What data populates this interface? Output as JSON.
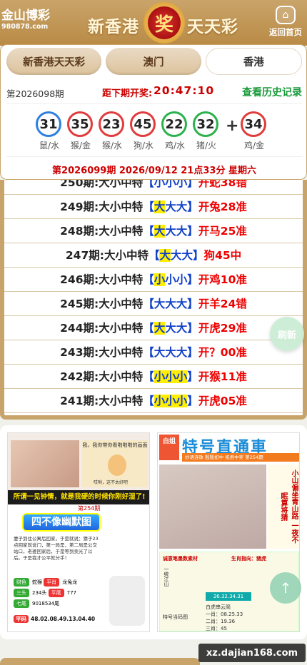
{
  "header": {
    "brand_name": "金山博彩",
    "brand_url": "980878.com",
    "title_left": "新香港",
    "title_right": "天天彩",
    "logo_char": "奖",
    "home_label": "返回首页"
  },
  "tabs": [
    {
      "label": "新香港天天彩",
      "active": false
    },
    {
      "label": "澳门",
      "active": false
    },
    {
      "label": "香港",
      "active": true
    }
  ],
  "result": {
    "period": "第2026098期",
    "next_label": "距下期开奖:",
    "countdown": "20:47:10",
    "history_link": "查看历史记录",
    "balls": [
      {
        "num": "31",
        "label": "鼠/水",
        "color": "#2d7fe0"
      },
      {
        "num": "35",
        "label": "猴/金",
        "color": "#e23b3b"
      },
      {
        "num": "23",
        "label": "猴/水",
        "color": "#e23b3b"
      },
      {
        "num": "45",
        "label": "狗/水",
        "color": "#e23b3b"
      },
      {
        "num": "22",
        "label": "鸡/水",
        "color": "#2bb24c"
      },
      {
        "num": "32",
        "label": "猪/火",
        "color": "#2bb24c"
      }
    ],
    "plus": "+",
    "special": {
      "num": "34",
      "label": "鸡/金",
      "color": "#e23b3b"
    },
    "next_draw": "第2026099期 2026/09/12 21点33分 星期六"
  },
  "history": [
    {
      "period": "250期:大小中特",
      "pick": [
        "小",
        "小",
        "小"
      ],
      "hl": -1,
      "result": "开蛇38错"
    },
    {
      "period": "249期:大小中特",
      "pick": [
        "大",
        "大",
        "大"
      ],
      "hl": 0,
      "result": "开兔28准"
    },
    {
      "period": "248期:大小中特",
      "pick": [
        "大",
        "大",
        "大"
      ],
      "hl": 0,
      "result": "开马25准"
    },
    {
      "period": "247期:大小中特",
      "pick": [
        "大",
        "大",
        "大"
      ],
      "hl": 0,
      "result": "狗45中"
    },
    {
      "period": "246期:大小中特",
      "pick": [
        "小",
        "小",
        "小"
      ],
      "hl": 0,
      "result": "开鸡10准"
    },
    {
      "period": "245期:大小中特",
      "pick": [
        "大",
        "大",
        "大"
      ],
      "hl": -1,
      "result": "开羊24错"
    },
    {
      "period": "244期:大小中特",
      "pick": [
        "大",
        "大",
        "大"
      ],
      "hl": 0,
      "result": "开虎29准"
    },
    {
      "period": "243期:大小中特",
      "pick": [
        "大",
        "大",
        "大"
      ],
      "hl": -1,
      "result": "开？00准"
    },
    {
      "period": "242期:大小中特",
      "pick": [
        "小",
        "小",
        "小"
      ],
      "hl": 9,
      "result": "开猴11准"
    },
    {
      "period": "241期:大小中特",
      "pick": [
        "小",
        "小",
        "小"
      ],
      "hl": 9,
      "result": "开虎05准"
    }
  ],
  "refresh_label": "刷新",
  "pic1": {
    "comic_caption": "我，我你带你看啪啪啪的画面",
    "comic_caption2": "哎哟，这不太好吧",
    "slogan": "所谓一见钟情，就是我硬的时候你刚好湿了!",
    "poster_title": "四不像幽默图",
    "poster_issue": "第254期",
    "poster_text": "妻子到住公寓后回家，于是就说：猜子23点回家就说门，第一局是，第二局是公交站口，老婆回家后，于是等到卖光了以后。于是我才公平就分手！",
    "tags": [
      {
        "label": "财色",
        "value": "蛇猴"
      },
      {
        "label": "平肖",
        "value": "龙兔龙"
      },
      {
        "label": "三头",
        "value": "234头"
      },
      {
        "label": "平尾",
        "value": "777"
      },
      {
        "label": "七尾",
        "value": "9018534尾"
      }
    ],
    "nums_label": "平码",
    "nums": "48.02.08.49.13.04.40"
  },
  "pic2": {
    "side_badge": "白姐",
    "title": "特号直通車",
    "subtitle": "全新奉献",
    "slogan": "妙语连珠 殷殷如中 祝君中奖 第254期",
    "side_text": "小山偏坐青山路 一夜不眠算将猜",
    "grid_red1": "诚意笔墨数素材",
    "grid_red2": "生肖指向：猪虎",
    "grid_teal": "26.32.34.31",
    "grid_l1": "一统江山",
    "grid_l2": "特号当码图",
    "grid_l3": "白虎串云简",
    "grid_n1": "一肖：08.25.33",
    "grid_n2": "二肖：19.36",
    "grid_n3": "三肖：45"
  },
  "watermark": "xz.dajian168.com"
}
